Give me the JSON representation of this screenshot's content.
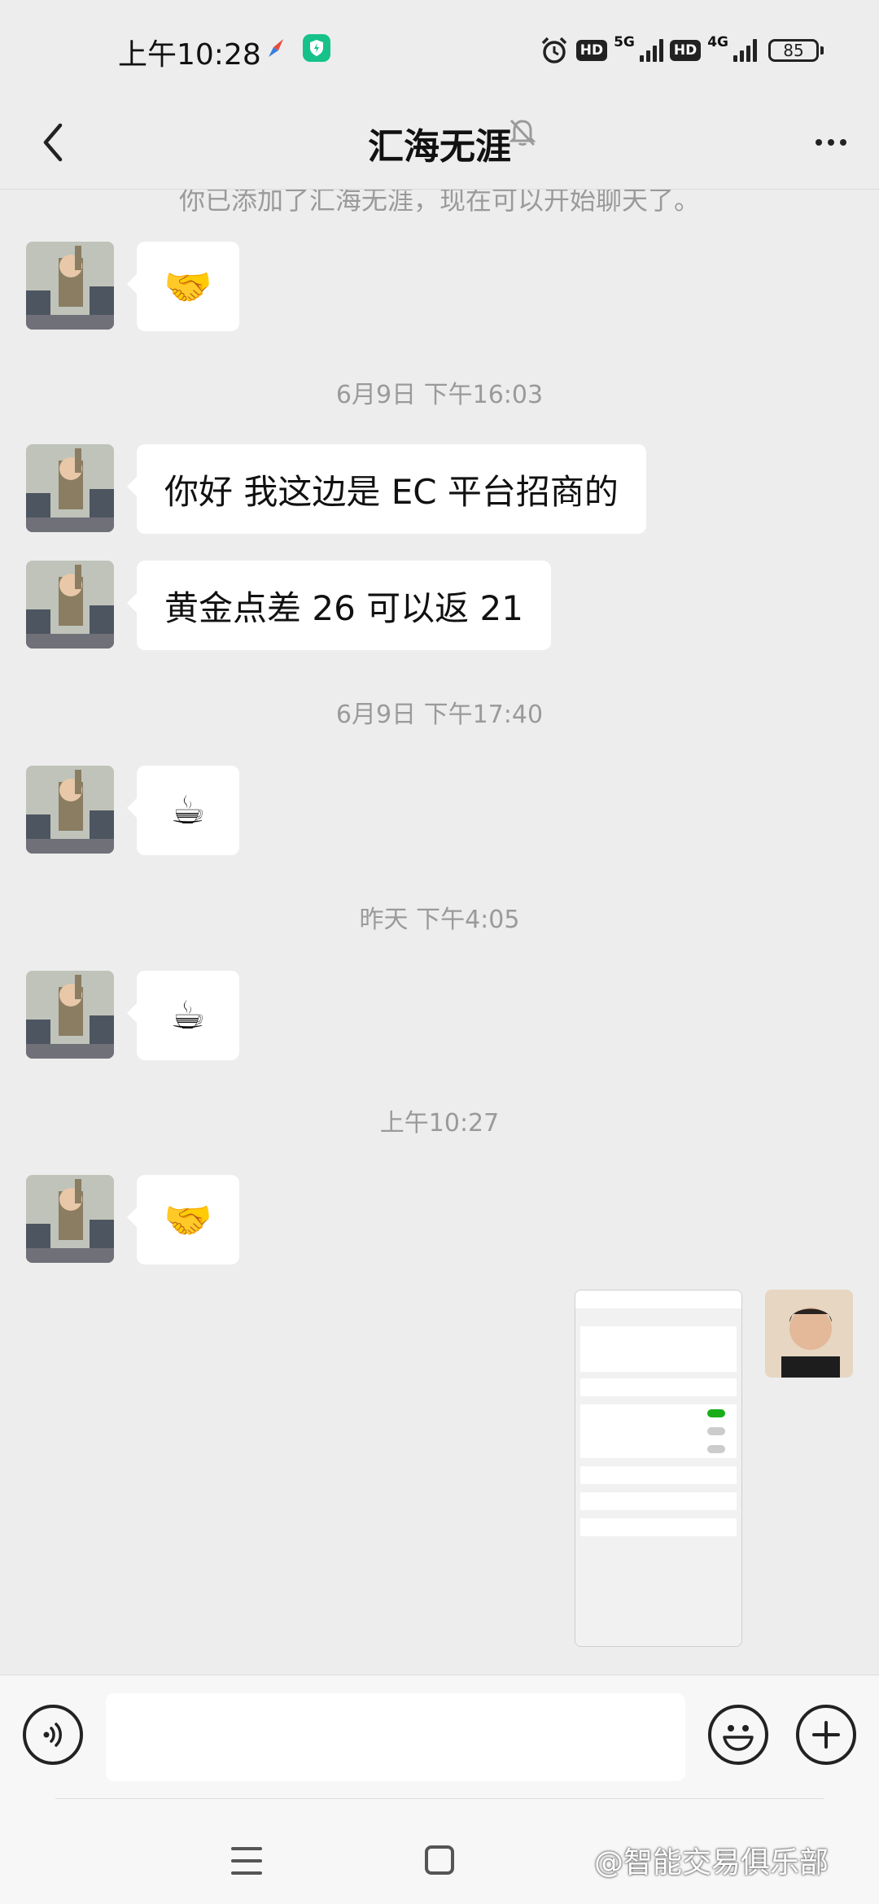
{
  "status_bar": {
    "time": "上午10:28",
    "hd_label": "HD",
    "network_1": "5G",
    "network_2": "4G",
    "battery": "85",
    "icons": [
      "compass-icon",
      "shield-icon",
      "alarm-icon",
      "signal-icon",
      "battery-icon"
    ]
  },
  "header": {
    "title": "汇海无涯",
    "icons": [
      "back-arrow-icon",
      "mute-bell-icon",
      "more-icon"
    ]
  },
  "chat": {
    "system_notice": "你已添加了汇海无涯，现在可以开始聊天了。",
    "messages": [
      {
        "sender": "contact",
        "type": "emoji",
        "content": "🤝"
      },
      {
        "type": "timestamp",
        "content": "6月9日 下午16:03"
      },
      {
        "sender": "contact",
        "type": "text",
        "content": "你好 我这边是 EC 平台招商的"
      },
      {
        "sender": "contact",
        "type": "text",
        "content": "黄金点差 26 可以返 21"
      },
      {
        "type": "timestamp",
        "content": "6月9日 下午17:40"
      },
      {
        "sender": "contact",
        "type": "emoji",
        "content": "☕"
      },
      {
        "type": "timestamp",
        "content": "昨天 下午4:05"
      },
      {
        "sender": "contact",
        "type": "emoji",
        "content": "☕"
      },
      {
        "type": "timestamp",
        "content": "上午10:27"
      },
      {
        "sender": "contact",
        "type": "emoji",
        "content": "🤝"
      },
      {
        "sender": "me",
        "type": "image",
        "content": "screenshot"
      }
    ]
  },
  "input_bar": {
    "value": "",
    "icons": [
      "voice-icon",
      "emoji-icon",
      "plus-icon"
    ]
  },
  "nav_bar": {
    "watermark": "@智能交易俱乐部",
    "icons": [
      "menu-icon",
      "home-icon"
    ]
  },
  "colors": {
    "background": "#ededed",
    "bubble": "#ffffff",
    "timestamp_text": "#9a9a9a",
    "shield": "#16c28a"
  }
}
